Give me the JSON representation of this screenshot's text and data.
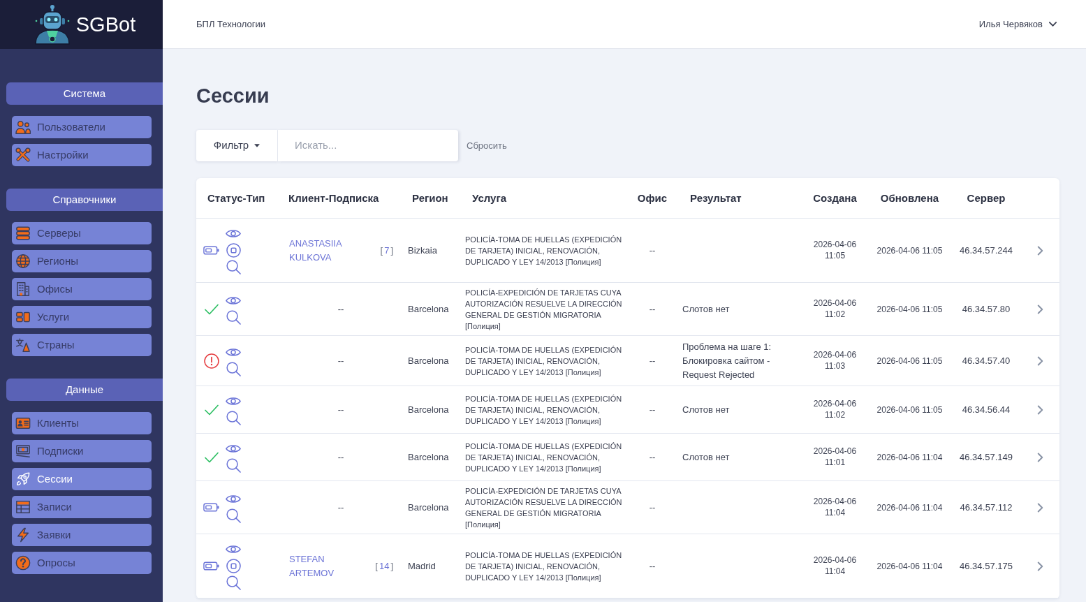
{
  "sidebar": {
    "brand": "SGBot",
    "sections": [
      {
        "title": "Система",
        "items": [
          {
            "label": "Пользователи",
            "selected": false
          },
          {
            "label": "Настройки",
            "selected": false
          }
        ]
      },
      {
        "title": "Справочники",
        "items": [
          {
            "label": "Серверы",
            "selected": false
          },
          {
            "label": "Регионы",
            "selected": false
          },
          {
            "label": "Офисы",
            "selected": false
          },
          {
            "label": "Услуги",
            "selected": false
          },
          {
            "label": "Страны",
            "selected": false
          }
        ]
      },
      {
        "title": "Данные",
        "items": [
          {
            "label": "Клиенты",
            "selected": false
          },
          {
            "label": "Подписки",
            "selected": false
          },
          {
            "label": "Сессии",
            "selected": true
          },
          {
            "label": "Записи",
            "selected": false
          },
          {
            "label": "Заявки",
            "selected": false
          },
          {
            "label": "Опросы",
            "selected": false
          }
        ]
      }
    ]
  },
  "header": {
    "company": "БПЛ Технологии",
    "user": "Илья Червяков"
  },
  "page": {
    "title": "Сессии"
  },
  "filter": {
    "button": "Фильтр",
    "placeholder": "Искать...",
    "reset": "Сбросить"
  },
  "table": {
    "columns": [
      "Статус-Тип",
      "Клиент-Подписка",
      "Регион",
      "Услуга",
      "Офис",
      "Результат",
      "Создана",
      "Обновлена",
      "Сервер"
    ],
    "rows": [
      {
        "kind": "active",
        "can_stop": true,
        "client": {
          "kind": "link",
          "name": "ANASTASIIA KULKOVA",
          "subscription": {
            "open": "[",
            "number": "7",
            "close": "]"
          }
        },
        "region": "Bizkaia",
        "service": "POLICÍA-TOMA DE HUELLAS (EXPEDICIÓN DE TARJETA) INICIAL, RENOVACIÓN, DUPLICADO Y LEY 14/2013 [Полиция]",
        "office": "--",
        "created": "2026-04-06 11:05",
        "updated": "2026-04-06 11:05",
        "server": "46.34.57.244"
      },
      {
        "kind": "success",
        "can_stop": false,
        "client": {
          "kind": "none",
          "text": "--"
        },
        "region": "Barcelona",
        "service": "POLICÍA-EXPEDICIÓN DE TARJETAS CUYA AUTORIZACIÓN RESUELVE LA DIRECCIÓN GENERAL DE GESTIÓN MIGRATORIA [Полиция]",
        "office": "--",
        "result": "Слотов нет",
        "created": "2026-04-06 11:02",
        "updated": "2026-04-06 11:05",
        "server": "46.34.57.80"
      },
      {
        "kind": "error",
        "can_stop": false,
        "client": {
          "kind": "none",
          "text": "--"
        },
        "region": "Barcelona",
        "service": "POLICÍA-TOMA DE HUELLAS (EXPEDICIÓN DE TARJETA) INICIAL, RENOVACIÓN, DUPLICADO Y LEY 14/2013 [Полиция]",
        "office": "--",
        "result": "Проблема на шаге 1: Блокировка сайтом - Request Rejected",
        "created": "2026-04-06 11:03",
        "updated": "2026-04-06 11:05",
        "server": "46.34.57.40"
      },
      {
        "kind": "success",
        "can_stop": false,
        "client": {
          "kind": "none",
          "text": "--"
        },
        "region": "Barcelona",
        "service": "POLICÍA-TOMA DE HUELLAS (EXPEDICIÓN DE TARJETA) INICIAL, RENOVACIÓN, DUPLICADO Y LEY 14/2013 [Полиция]",
        "office": "--",
        "result": "Слотов нет",
        "created": "2026-04-06 11:02",
        "updated": "2026-04-06 11:05",
        "server": "46.34.56.44"
      },
      {
        "kind": "success",
        "can_stop": false,
        "client": {
          "kind": "none",
          "text": "--"
        },
        "region": "Barcelona",
        "service": "POLICÍA-TOMA DE HUELLAS (EXPEDICIÓN DE TARJETA) INICIAL, RENOVACIÓN, DUPLICADO Y LEY 14/2013 [Полиция]",
        "office": "--",
        "result": "Слотов нет",
        "created": "2026-04-06 11:01",
        "updated": "2026-04-06 11:04",
        "server": "46.34.57.149"
      },
      {
        "kind": "active",
        "can_stop": false,
        "client": {
          "kind": "none",
          "text": "--"
        },
        "region": "Barcelona",
        "service": "POLICÍA-EXPEDICIÓN DE TARJETAS CUYA AUTORIZACIÓN RESUELVE LA DIRECCIÓN GENERAL DE GESTIÓN MIGRATORIA [Полиция]",
        "office": "--",
        "created": "2026-04-06 11:04",
        "updated": "2026-04-06 11:04",
        "server": "46.34.57.112"
      },
      {
        "kind": "active",
        "can_stop": true,
        "client": {
          "kind": "link",
          "name": "STEFAN ARTEMOV",
          "subscription": {
            "open": "[",
            "number": "14",
            "close": "]"
          }
        },
        "region": "Madrid",
        "service": "POLICÍA-TOMA DE HUELLAS (EXPEDICIÓN DE TARJETA) INICIAL, RENOVACIÓN, DUPLICADO Y LEY 14/2013 [Полиция]",
        "office": "--",
        "created": "2026-04-06 11:04",
        "updated": "2026-04-06 11:04",
        "server": "46.34.57.175"
      }
    ]
  }
}
